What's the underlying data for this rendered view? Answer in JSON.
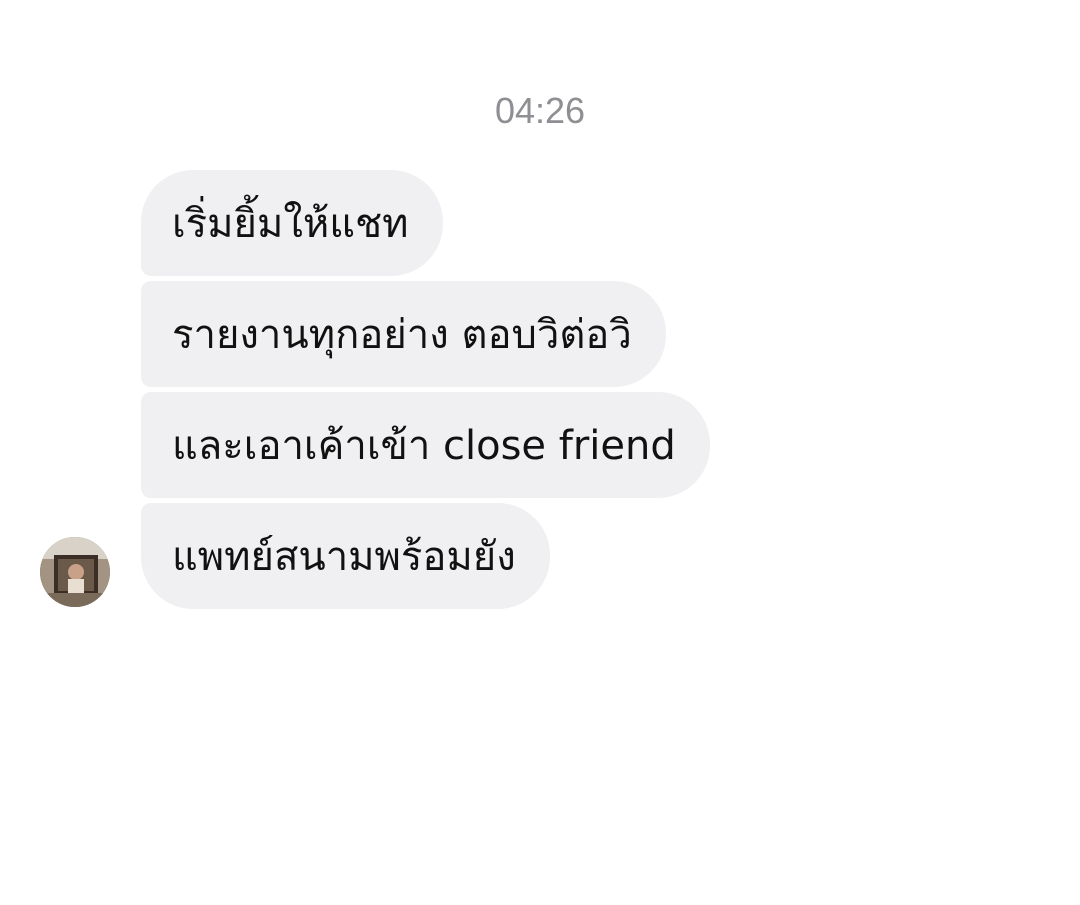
{
  "chat": {
    "timestamp": "04:26",
    "messages": [
      {
        "text": "เริ่มยิ้มให้แชท"
      },
      {
        "text": "รายงานทุกอย่าง ตอบวิต่อวิ"
      },
      {
        "text": "และเอาเค้าเข้า close friend"
      },
      {
        "text": "แพทย์สนามพร้อมยัง"
      }
    ],
    "sender_avatar": "profile-photo"
  },
  "colors": {
    "bubble_background": "#f0f0f2",
    "timestamp_text": "#8e8e93",
    "message_text": "#111111"
  }
}
